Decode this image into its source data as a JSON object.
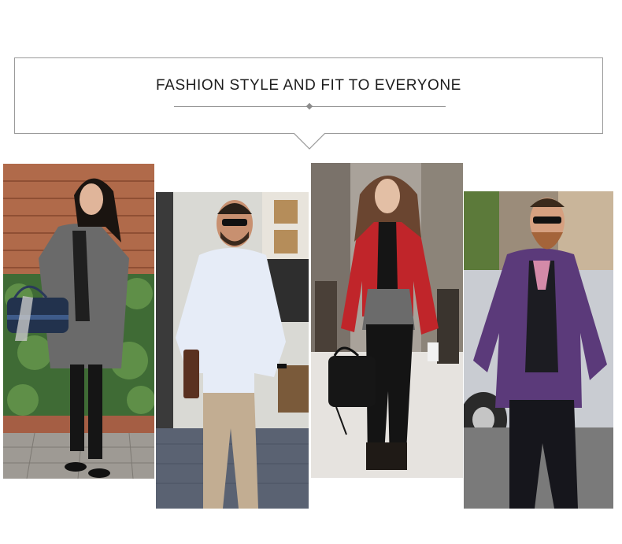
{
  "banner": {
    "title": "FASHION STYLE AND FIT TO EVERYONE"
  },
  "photos": [
    {
      "name": "woman-grey-coat-photo",
      "subject": "woman in grey coat with blue handbag and black boots"
    },
    {
      "name": "man-white-shirt-photo",
      "subject": "man in white shirt and khaki pants with brown clutch"
    },
    {
      "name": "woman-red-jacket-photo",
      "subject": "woman in red leather jacket with black handbag"
    },
    {
      "name": "man-purple-blazer-photo",
      "subject": "man in purple blazer with sunglasses"
    }
  ],
  "colors": {
    "border": "#9a9a9a",
    "title": "#1c1c1c",
    "accent_red": "#c0252a",
    "accent_purple": "#5b3a7a"
  }
}
